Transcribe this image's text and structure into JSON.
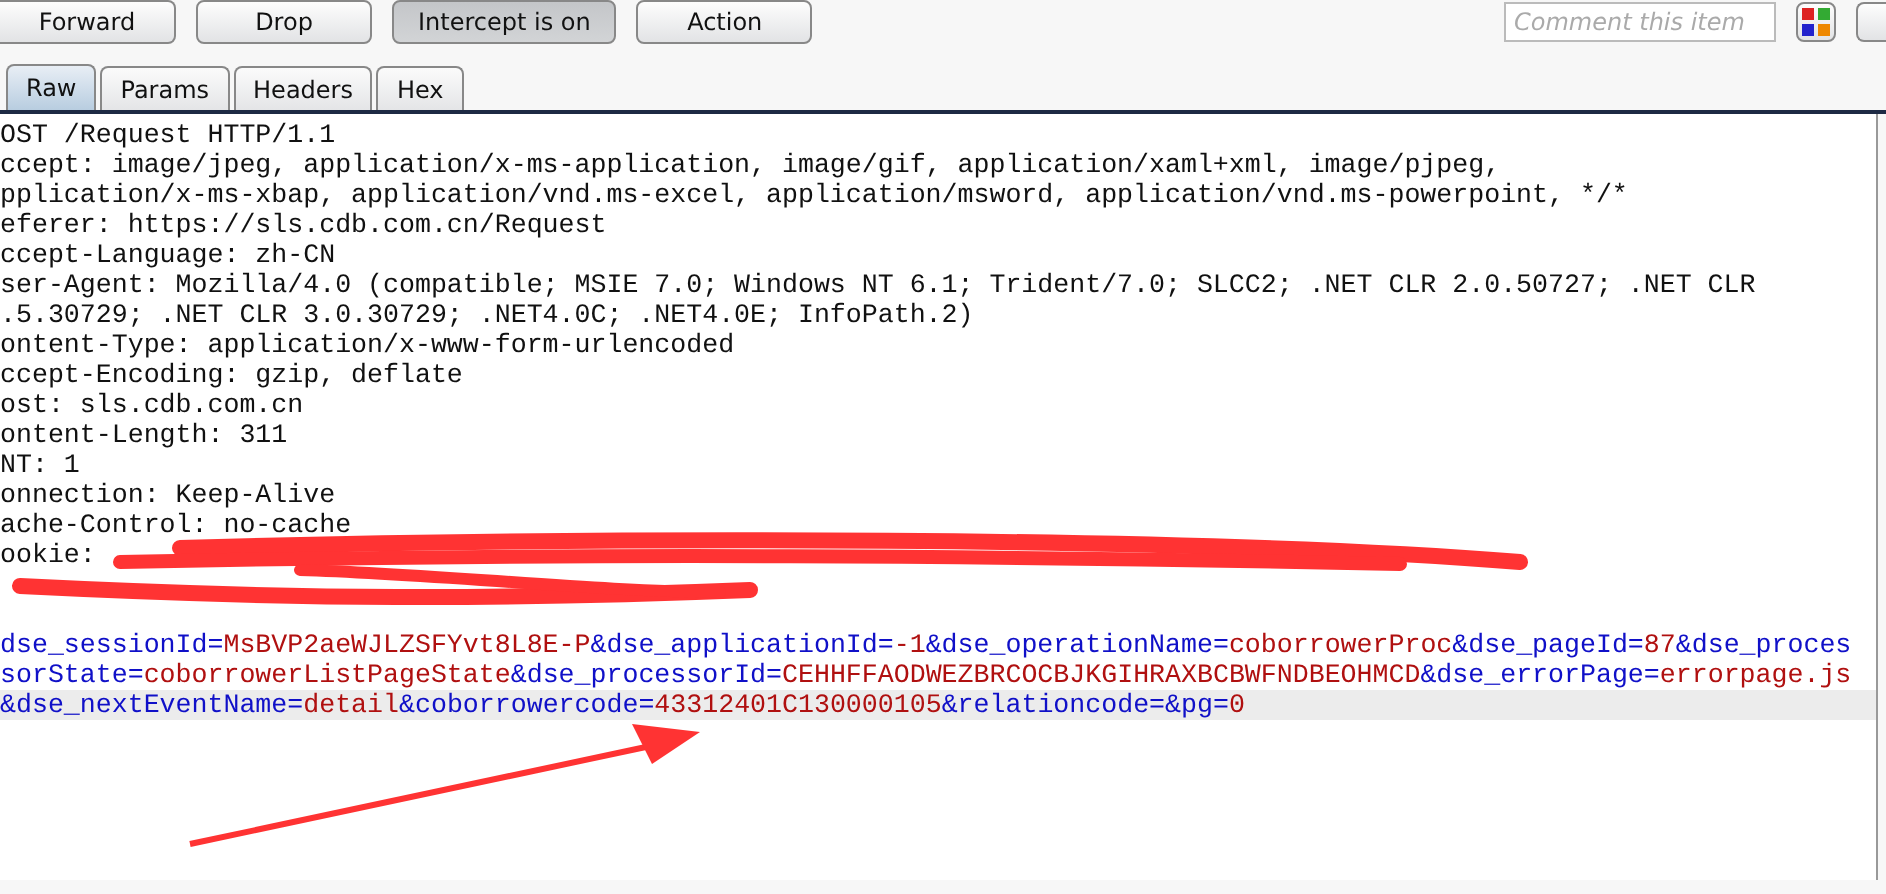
{
  "toolbar": {
    "buttons": [
      {
        "label": "Forward",
        "pressed": false
      },
      {
        "label": "Drop",
        "pressed": false
      },
      {
        "label": "Intercept is on",
        "pressed": true
      },
      {
        "label": "Action",
        "pressed": false
      }
    ],
    "comment": {
      "placeholder": "Comment this item"
    }
  },
  "tabs": [
    {
      "label": "Raw",
      "selected": true
    },
    {
      "label": "Params",
      "selected": false
    },
    {
      "label": "Headers",
      "selected": false
    },
    {
      "label": "Hex",
      "selected": false
    }
  ],
  "editor": {
    "lines": [
      {
        "selected": false,
        "segments": [
          {
            "kind": "plain",
            "text": "OST /Request HTTP/1.1"
          }
        ]
      },
      {
        "selected": false,
        "segments": [
          {
            "kind": "plain",
            "text": "ccept: image/jpeg, application/x-ms-application, image/gif, application/xaml+xml, image/pjpeg,"
          }
        ]
      },
      {
        "selected": false,
        "segments": [
          {
            "kind": "plain",
            "text": "pplication/x-ms-xbap, application/vnd.ms-excel, application/msword, application/vnd.ms-powerpoint, */*"
          }
        ]
      },
      {
        "selected": false,
        "segments": [
          {
            "kind": "plain",
            "text": "eferer: https://sls.cdb.com.cn/Request"
          }
        ]
      },
      {
        "selected": false,
        "segments": [
          {
            "kind": "plain",
            "text": "ccept-Language: zh-CN"
          }
        ]
      },
      {
        "selected": false,
        "segments": [
          {
            "kind": "plain",
            "text": "ser-Agent: Mozilla/4.0 (compatible; MSIE 7.0; Windows NT 6.1; Trident/7.0; SLCC2; .NET CLR 2.0.50727; .NET CLR"
          }
        ]
      },
      {
        "selected": false,
        "segments": [
          {
            "kind": "plain",
            "text": ".5.30729; .NET CLR 3.0.30729; .NET4.0C; .NET4.0E; InfoPath.2)"
          }
        ]
      },
      {
        "selected": false,
        "segments": [
          {
            "kind": "plain",
            "text": "ontent-Type: application/x-www-form-urlencoded"
          }
        ]
      },
      {
        "selected": false,
        "segments": [
          {
            "kind": "plain",
            "text": "ccept-Encoding: gzip, deflate"
          }
        ]
      },
      {
        "selected": false,
        "segments": [
          {
            "kind": "plain",
            "text": "ost: sls.cdb.com.cn"
          }
        ]
      },
      {
        "selected": false,
        "segments": [
          {
            "kind": "plain",
            "text": "ontent-Length: 311"
          }
        ]
      },
      {
        "selected": false,
        "segments": [
          {
            "kind": "plain",
            "text": "NT: 1"
          }
        ]
      },
      {
        "selected": false,
        "segments": [
          {
            "kind": "plain",
            "text": "onnection: Keep-Alive"
          }
        ]
      },
      {
        "selected": false,
        "segments": [
          {
            "kind": "plain",
            "text": "ache-Control: no-cache"
          }
        ]
      },
      {
        "selected": false,
        "segments": [
          {
            "kind": "plain",
            "text": "ookie:"
          }
        ]
      },
      {
        "selected": false
      },
      {
        "selected": false
      },
      {
        "selected": false,
        "segments": [
          {
            "kind": "name",
            "text": "dse_sessionId="
          },
          {
            "kind": "value",
            "text": "MsBVP2aeWJLZSFYvt8L8E-P"
          },
          {
            "kind": "name",
            "text": "&dse_applicationId="
          },
          {
            "kind": "value",
            "text": "-1"
          },
          {
            "kind": "name",
            "text": "&dse_operationName="
          },
          {
            "kind": "value",
            "text": "coborrowerProc"
          },
          {
            "kind": "name",
            "text": "&dse_pageId="
          },
          {
            "kind": "value",
            "text": "87"
          },
          {
            "kind": "name",
            "text": "&dse_proces"
          }
        ]
      },
      {
        "selected": false,
        "segments": [
          {
            "kind": "name",
            "text": "sorState="
          },
          {
            "kind": "value",
            "text": "coborrowerListPageState"
          },
          {
            "kind": "name",
            "text": "&dse_processorId="
          },
          {
            "kind": "value",
            "text": "CEHHFFAODWEZBRCOCBJKGIHRAXBCBWFNDBEOHMCD"
          },
          {
            "kind": "name",
            "text": "&dse_errorPage="
          },
          {
            "kind": "value",
            "text": "errorpage.js"
          }
        ]
      },
      {
        "selected": true,
        "segments": [
          {
            "kind": "name",
            "text": "&dse_nextEventName="
          },
          {
            "kind": "value",
            "text": "detail"
          },
          {
            "kind": "name",
            "text": "&coborrowercode="
          },
          {
            "kind": "value",
            "text": "43312401C130000105"
          },
          {
            "kind": "name",
            "text": "&relationcode=&pg="
          },
          {
            "kind": "value",
            "text": "0"
          }
        ]
      }
    ]
  }
}
